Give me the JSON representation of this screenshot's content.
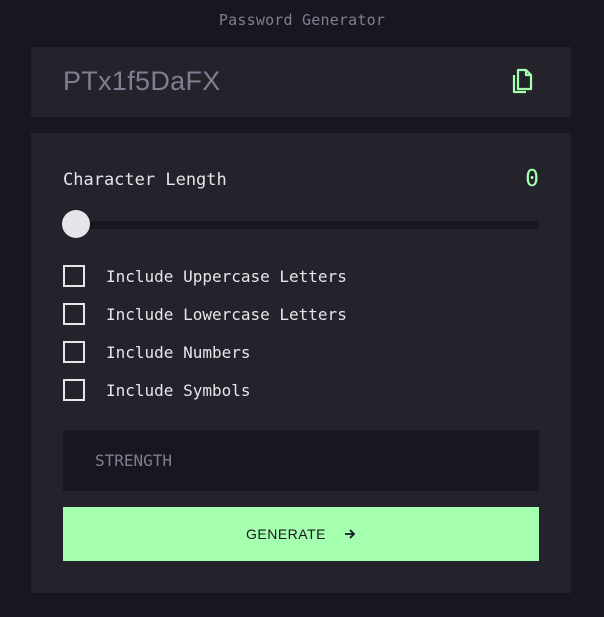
{
  "app": {
    "title": "Password Generator"
  },
  "output": {
    "password": "PTx1f5DaFX",
    "copy_icon": "copy-icon"
  },
  "length": {
    "label": "Character Length",
    "value": "0",
    "slider_fraction": 0
  },
  "options": [
    {
      "label": "Include Uppercase Letters",
      "checked": false
    },
    {
      "label": "Include Lowercase Letters",
      "checked": false
    },
    {
      "label": "Include Numbers",
      "checked": false
    },
    {
      "label": "Include Symbols",
      "checked": false
    }
  ],
  "strength": {
    "label": "STRENGTH"
  },
  "generate": {
    "label": "GENERATE",
    "icon": "arrow-right-icon"
  },
  "colors": {
    "background": "#18171f",
    "panel": "#24232c",
    "accent": "#a4ffaf",
    "muted": "#817d92",
    "text": "#e6e5ea"
  }
}
